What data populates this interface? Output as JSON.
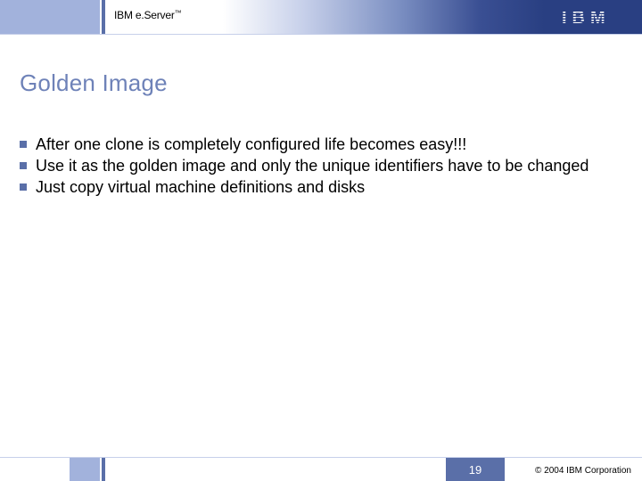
{
  "header": {
    "product": "IBM e.Server",
    "tm": "™",
    "logo_text": "IBM"
  },
  "title": "Golden Image",
  "bullets": [
    "After one clone is completely configured life becomes easy!!!",
    "Use it as the golden image and only the unique identifiers have to be changed",
    "Just copy virtual machine definitions and disks"
  ],
  "footer": {
    "page": "19",
    "copyright": "© 2004 IBM Corporation"
  }
}
